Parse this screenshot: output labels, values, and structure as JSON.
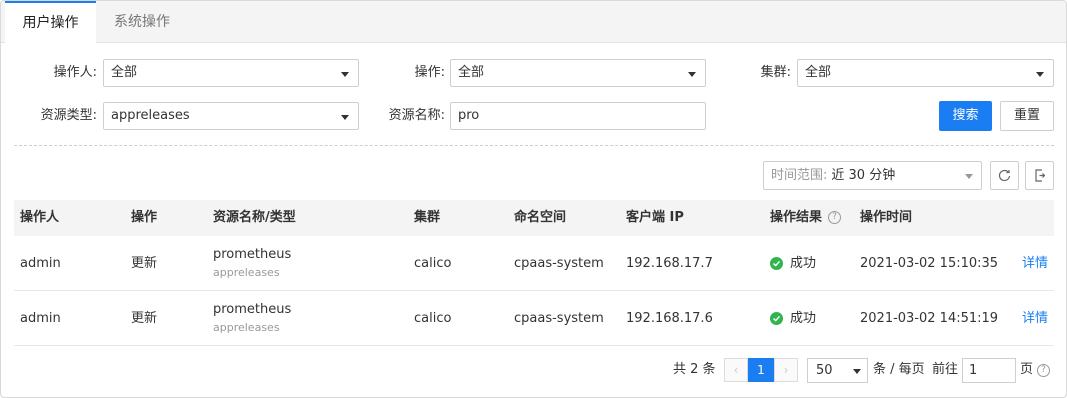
{
  "tabs": [
    {
      "label": "用户操作",
      "active": true
    },
    {
      "label": "系统操作",
      "active": false
    }
  ],
  "filters": {
    "operator": {
      "label": "操作人:",
      "value": "全部"
    },
    "action": {
      "label": "操作:",
      "value": "全部"
    },
    "cluster": {
      "label": "集群:",
      "value": "全部"
    },
    "resource_type": {
      "label": "资源类型:",
      "value": "appreleases"
    },
    "resource_name": {
      "label": "资源名称:",
      "value": "pro"
    },
    "search_label": "搜索",
    "reset_label": "重置"
  },
  "time_range": {
    "label": "时间范围:",
    "value": "近 30 分钟"
  },
  "toolbar_icons": [
    "refresh-icon",
    "export-icon"
  ],
  "table": {
    "columns": [
      "操作人",
      "操作",
      "资源名称/类型",
      "集群",
      "命名空间",
      "客户端 IP",
      "操作结果",
      "操作时间"
    ],
    "rows": [
      {
        "operator": "admin",
        "action": "更新",
        "resource_name": "prometheus",
        "resource_type": "appreleases",
        "cluster": "calico",
        "namespace": "cpaas-system",
        "client_ip": "192.168.17.7",
        "result": "成功",
        "time": "2021-03-02 15:10:35",
        "detail": "详情"
      },
      {
        "operator": "admin",
        "action": "更新",
        "resource_name": "prometheus",
        "resource_type": "appreleases",
        "cluster": "calico",
        "namespace": "cpaas-system",
        "client_ip": "192.168.17.6",
        "result": "成功",
        "time": "2021-03-02 14:51:19",
        "detail": "详情"
      }
    ]
  },
  "pagination": {
    "total_text": "共 2 条",
    "prev": "‹",
    "current_page": "1",
    "next": "›",
    "page_size": "50",
    "per_page_text": "条 / 每页",
    "goto_text": "前往",
    "goto_value": "1",
    "page_text": "页"
  },
  "colors": {
    "accent": "#1a7ef2",
    "success": "#2fb44e",
    "header_bg": "#f4f4f4"
  }
}
